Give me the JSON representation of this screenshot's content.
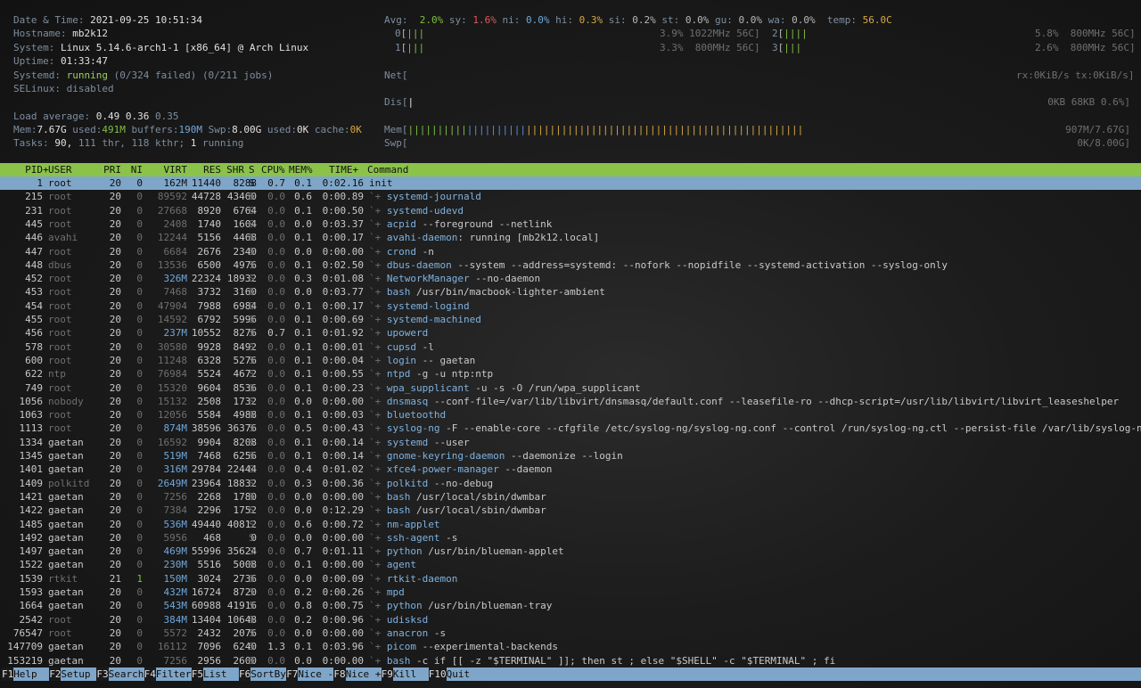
{
  "system": {
    "datetime_label": "Date & Time:",
    "datetime": "2021-09-25 10:51:34",
    "hostname_label": "Hostname:",
    "hostname": "mb2k12",
    "system_label": "System:",
    "system": "Linux 5.14.6-arch1-1 [x86_64] @ Arch Linux",
    "uptime_label": "Uptime:",
    "uptime": "01:33:47",
    "systemd_label": "Systemd:",
    "systemd_state": "running",
    "systemd_failed": "(0/324 failed)",
    "systemd_jobs": "(0/211 jobs)",
    "selinux_label": "SELinux:",
    "selinux": "disabled",
    "load_label": "Load average:",
    "load1": "0.49",
    "load5": "0.36",
    "load15": "0.35",
    "mem_label": "Mem:",
    "mem_total": "7.67G",
    "mem_used_label": "used:",
    "mem_used": "491M",
    "buffers_label": "buffers:",
    "buffers": "190M",
    "swp_label": "Swp:",
    "swp_total": "8.00G",
    "swp_used_label": "used:",
    "swp_used": "0K",
    "cache_label": "cache:",
    "cache": "0K",
    "tasks_label": "Tasks:",
    "tasks": "90,",
    "thr": "111 thr,",
    "kthr": "118 kthr;",
    "running": "1",
    "running_label": "running"
  },
  "cpu": {
    "avg_label": "Avg:",
    "stats": [
      {
        "label": "sy:",
        "value": "1.6%",
        "color": "#e05a5a"
      },
      {
        "label": "ni:",
        "value": "0.0%",
        "color": "#6fa8dc"
      },
      {
        "label": "hi:",
        "value": "0.3%",
        "color": "#d7a93f"
      },
      {
        "label": "si:",
        "value": "0.2%",
        "color": "#b8b8b8"
      },
      {
        "label": "st:",
        "value": "0.0%",
        "color": "#b8b8b8"
      },
      {
        "label": "gu:",
        "value": "0.0%",
        "color": "#b8b8b8"
      },
      {
        "label": "wa:",
        "value": "0.0%",
        "color": "#b8b8b8"
      }
    ],
    "avg_value": "2.0%",
    "temp_label": "temp:",
    "temp": "56.0C",
    "cores": [
      {
        "id": "0",
        "bars": "|||",
        "info": "3.9% 1022MHz 56C]"
      },
      {
        "id": "1",
        "bars": "|||",
        "info": "3.3%  800MHz 56C]"
      },
      {
        "id": "2",
        "bars": "||||",
        "info": "5.8%  800MHz 56C]"
      },
      {
        "id": "3",
        "bars": "|||",
        "info": "2.6%  800MHz 56C]"
      }
    ]
  },
  "meters": {
    "net_label": "Net[",
    "net_value": "rx:0KiB/s tx:0KiB/s]",
    "dis_label": "Dis[",
    "dis_value": "0KB 68KB 0.6%]",
    "mem_label": "Mem[",
    "mem_value": "907M/7.67G]",
    "swp_label": "Swp[",
    "swp_value": "0K/8.00G]"
  },
  "table": {
    "headers": [
      "PID",
      "USER",
      "PRI",
      "NI",
      "VIRT",
      "RES",
      "SHR",
      "S",
      "CPU%",
      "MEM%",
      "TIME+",
      "Command"
    ],
    "rows": [
      {
        "pid": "1",
        "user": "root",
        "pri": "20",
        "ni": "0",
        "virt": "162M",
        "res": "11440",
        "shr": "8288",
        "s": "S",
        "cpu": "0.7",
        "mem": "0.1",
        "time": "0:02.16",
        "cmd": "init",
        "args": ""
      },
      {
        "pid": "215",
        "user": "root",
        "pri": "20",
        "ni": "0",
        "virt": "89592",
        "res": "44728",
        "shr": "43460",
        "s": "S",
        "cpu": "0.0",
        "mem": "0.6",
        "time": "0:00.89",
        "cmd": "systemd-journald",
        "args": ""
      },
      {
        "pid": "231",
        "user": "root",
        "pri": "20",
        "ni": "0",
        "virt": "27668",
        "res": "8920",
        "shr": "6764",
        "s": "S",
        "cpu": "0.0",
        "mem": "0.1",
        "time": "0:00.50",
        "cmd": "systemd-udevd",
        "args": ""
      },
      {
        "pid": "445",
        "user": "root",
        "pri": "20",
        "ni": "0",
        "virt": "2408",
        "res": "1740",
        "shr": "1604",
        "s": "S",
        "cpu": "0.0",
        "mem": "0.0",
        "time": "0:03.37",
        "cmd": "acpid",
        "args": " --foreground --netlink"
      },
      {
        "pid": "446",
        "user": "avahi",
        "pri": "20",
        "ni": "0",
        "virt": "12244",
        "res": "5156",
        "shr": "4468",
        "s": "S",
        "cpu": "0.0",
        "mem": "0.1",
        "time": "0:00.17",
        "cmd": "avahi-daemon",
        "args": ": running [mb2k12.local]"
      },
      {
        "pid": "447",
        "user": "root",
        "pri": "20",
        "ni": "0",
        "virt": "6684",
        "res": "2676",
        "shr": "2340",
        "s": "S",
        "cpu": "0.0",
        "mem": "0.0",
        "time": "0:00.00",
        "cmd": "crond",
        "args": " -n"
      },
      {
        "pid": "448",
        "user": "dbus",
        "pri": "20",
        "ni": "0",
        "virt": "13536",
        "res": "6500",
        "shr": "4976",
        "s": "S",
        "cpu": "0.0",
        "mem": "0.1",
        "time": "0:02.50",
        "cmd": "dbus-daemon",
        "args": " --system --address=systemd: --nofork --nopidfile --systemd-activation --syslog-only"
      },
      {
        "pid": "452",
        "user": "root",
        "pri": "20",
        "ni": "0",
        "virt": "326M",
        "res": "22324",
        "shr": "18932",
        "s": "S",
        "cpu": "0.0",
        "mem": "0.3",
        "time": "0:01.08",
        "cmd": "NetworkManager",
        "args": " --no-daemon"
      },
      {
        "pid": "453",
        "user": "root",
        "pri": "20",
        "ni": "0",
        "virt": "7468",
        "res": "3732",
        "shr": "3160",
        "s": "S",
        "cpu": "0.0",
        "mem": "0.0",
        "time": "0:03.77",
        "cmd": "bash",
        "args": " /usr/bin/macbook-lighter-ambient"
      },
      {
        "pid": "454",
        "user": "root",
        "pri": "20",
        "ni": "0",
        "virt": "47904",
        "res": "7988",
        "shr": "6984",
        "s": "S",
        "cpu": "0.0",
        "mem": "0.1",
        "time": "0:00.17",
        "cmd": "systemd-logind",
        "args": ""
      },
      {
        "pid": "455",
        "user": "root",
        "pri": "20",
        "ni": "0",
        "virt": "14592",
        "res": "6792",
        "shr": "5996",
        "s": "S",
        "cpu": "0.0",
        "mem": "0.1",
        "time": "0:00.69",
        "cmd": "systemd-machined",
        "args": ""
      },
      {
        "pid": "456",
        "user": "root",
        "pri": "20",
        "ni": "0",
        "virt": "237M",
        "res": "10552",
        "shr": "8276",
        "s": "S",
        "cpu": "0.7",
        "mem": "0.1",
        "time": "0:01.92",
        "cmd": "upowerd",
        "args": ""
      },
      {
        "pid": "578",
        "user": "root",
        "pri": "20",
        "ni": "0",
        "virt": "30580",
        "res": "9928",
        "shr": "8492",
        "s": "S",
        "cpu": "0.0",
        "mem": "0.1",
        "time": "0:00.01",
        "cmd": "cupsd",
        "args": " -l"
      },
      {
        "pid": "600",
        "user": "root",
        "pri": "20",
        "ni": "0",
        "virt": "11248",
        "res": "6328",
        "shr": "5276",
        "s": "S",
        "cpu": "0.0",
        "mem": "0.1",
        "time": "0:00.04",
        "cmd": "login",
        "args": " -- gaetan"
      },
      {
        "pid": "622",
        "user": "ntp",
        "pri": "20",
        "ni": "0",
        "virt": "76984",
        "res": "5524",
        "shr": "4672",
        "s": "S",
        "cpu": "0.0",
        "mem": "0.1",
        "time": "0:00.55",
        "cmd": "ntpd",
        "args": " -g -u ntp:ntp"
      },
      {
        "pid": "749",
        "user": "root",
        "pri": "20",
        "ni": "0",
        "virt": "15320",
        "res": "9604",
        "shr": "8536",
        "s": "S",
        "cpu": "0.0",
        "mem": "0.1",
        "time": "0:00.23",
        "cmd": "wpa_supplicant",
        "args": " -u -s -O /run/wpa_supplicant"
      },
      {
        "pid": "1056",
        "user": "nobody",
        "pri": "20",
        "ni": "0",
        "virt": "15132",
        "res": "2508",
        "shr": "1732",
        "s": "S",
        "cpu": "0.0",
        "mem": "0.0",
        "time": "0:00.00",
        "cmd": "dnsmasq",
        "args": " --conf-file=/var/lib/libvirt/dnsmasq/default.conf --leasefile-ro --dhcp-script=/usr/lib/libvirt/libvirt_leaseshelper"
      },
      {
        "pid": "1063",
        "user": "root",
        "pri": "20",
        "ni": "0",
        "virt": "12056",
        "res": "5584",
        "shr": "4988",
        "s": "S",
        "cpu": "0.0",
        "mem": "0.1",
        "time": "0:00.03",
        "cmd": "bluetoothd",
        "args": ""
      },
      {
        "pid": "1113",
        "user": "root",
        "pri": "20",
        "ni": "0",
        "virt": "874M",
        "res": "38596",
        "shr": "36376",
        "s": "S",
        "cpu": "0.0",
        "mem": "0.5",
        "time": "0:00.43",
        "cmd": "syslog-ng",
        "args": " -F --enable-core --cfgfile /etc/syslog-ng/syslog-ng.conf --control /run/syslog-ng.ctl --persist-file /var/lib/syslog-ng/sysl"
      },
      {
        "pid": "1334",
        "user": "gaetan",
        "pri": "20",
        "ni": "0",
        "virt": "16592",
        "res": "9904",
        "shr": "8208",
        "s": "S",
        "cpu": "0.0",
        "mem": "0.1",
        "time": "0:00.14",
        "cmd": "systemd",
        "args": " --user"
      },
      {
        "pid": "1345",
        "user": "gaetan",
        "pri": "20",
        "ni": "0",
        "virt": "519M",
        "res": "7468",
        "shr": "6256",
        "s": "S",
        "cpu": "0.0",
        "mem": "0.1",
        "time": "0:00.14",
        "cmd": "gnome-keyring-daemon",
        "args": " --daemonize --login"
      },
      {
        "pid": "1401",
        "user": "gaetan",
        "pri": "20",
        "ni": "0",
        "virt": "316M",
        "res": "29784",
        "shr": "22444",
        "s": "S",
        "cpu": "0.0",
        "mem": "0.4",
        "time": "0:01.02",
        "cmd": "xfce4-power-manager",
        "args": " --daemon"
      },
      {
        "pid": "1409",
        "user": "polkitd",
        "pri": "20",
        "ni": "0",
        "virt": "2649M",
        "res": "23964",
        "shr": "18832",
        "s": "S",
        "cpu": "0.0",
        "mem": "0.3",
        "time": "0:00.36",
        "cmd": "polkitd",
        "args": " --no-debug"
      },
      {
        "pid": "1421",
        "user": "gaetan",
        "pri": "20",
        "ni": "0",
        "virt": "7256",
        "res": "2268",
        "shr": "1780",
        "s": "S",
        "cpu": "0.0",
        "mem": "0.0",
        "time": "0:00.00",
        "cmd": "bash",
        "args": " /usr/local/sbin/dwmbar"
      },
      {
        "pid": "1422",
        "user": "gaetan",
        "pri": "20",
        "ni": "0",
        "virt": "7384",
        "res": "2296",
        "shr": "1752",
        "s": "S",
        "cpu": "0.0",
        "mem": "0.0",
        "time": "0:12.29",
        "cmd": "bash",
        "args": " /usr/local/sbin/dwmbar"
      },
      {
        "pid": "1485",
        "user": "gaetan",
        "pri": "20",
        "ni": "0",
        "virt": "536M",
        "res": "49440",
        "shr": "40812",
        "s": "S",
        "cpu": "0.0",
        "mem": "0.6",
        "time": "0:00.72",
        "cmd": "nm-applet",
        "args": ""
      },
      {
        "pid": "1492",
        "user": "gaetan",
        "pri": "20",
        "ni": "0",
        "virt": "5956",
        "res": "468",
        "shr": "0",
        "s": "S",
        "cpu": "0.0",
        "mem": "0.0",
        "time": "0:00.00",
        "cmd": "ssh-agent",
        "args": " -s"
      },
      {
        "pid": "1497",
        "user": "gaetan",
        "pri": "20",
        "ni": "0",
        "virt": "469M",
        "res": "55996",
        "shr": "35624",
        "s": "S",
        "cpu": "0.0",
        "mem": "0.7",
        "time": "0:01.11",
        "cmd": "python",
        "args": " /usr/bin/blueman-applet"
      },
      {
        "pid": "1522",
        "user": "gaetan",
        "pri": "20",
        "ni": "0",
        "virt": "230M",
        "res": "5516",
        "shr": "5008",
        "s": "S",
        "cpu": "0.0",
        "mem": "0.1",
        "time": "0:00.00",
        "cmd": "agent",
        "args": ""
      },
      {
        "pid": "1539",
        "user": "rtkit",
        "pri": "21",
        "ni": "1",
        "virt": "150M",
        "res": "3024",
        "shr": "2736",
        "s": "S",
        "cpu": "0.0",
        "mem": "0.0",
        "time": "0:00.09",
        "cmd": "rtkit-daemon",
        "args": ""
      },
      {
        "pid": "1593",
        "user": "gaetan",
        "pri": "20",
        "ni": "0",
        "virt": "432M",
        "res": "16724",
        "shr": "8720",
        "s": "S",
        "cpu": "0.0",
        "mem": "0.2",
        "time": "0:00.26",
        "cmd": "mpd",
        "args": ""
      },
      {
        "pid": "1664",
        "user": "gaetan",
        "pri": "20",
        "ni": "0",
        "virt": "543M",
        "res": "60988",
        "shr": "41916",
        "s": "S",
        "cpu": "0.0",
        "mem": "0.8",
        "time": "0:00.75",
        "cmd": "python",
        "args": " /usr/bin/blueman-tray"
      },
      {
        "pid": "2542",
        "user": "root",
        "pri": "20",
        "ni": "0",
        "virt": "384M",
        "res": "13404",
        "shr": "10648",
        "s": "S",
        "cpu": "0.0",
        "mem": "0.2",
        "time": "0:00.96",
        "cmd": "udisksd",
        "args": ""
      },
      {
        "pid": "76547",
        "user": "root",
        "pri": "20",
        "ni": "0",
        "virt": "5572",
        "res": "2432",
        "shr": "2076",
        "s": "S",
        "cpu": "0.0",
        "mem": "0.0",
        "time": "0:00.00",
        "cmd": "anacron",
        "args": " -s"
      },
      {
        "pid": "147709",
        "user": "gaetan",
        "pri": "20",
        "ni": "0",
        "virt": "16112",
        "res": "7096",
        "shr": "6240",
        "s": "S",
        "cpu": "1.3",
        "mem": "0.1",
        "time": "0:03.96",
        "cmd": "picom",
        "args": " --experimental-backends"
      },
      {
        "pid": "153219",
        "user": "gaetan",
        "pri": "20",
        "ni": "0",
        "virt": "7256",
        "res": "2956",
        "shr": "2600",
        "s": "S",
        "cpu": "0.0",
        "mem": "0.0",
        "time": "0:00.00",
        "cmd": "bash",
        "args": " -c if [[ -z \"$TERMINAL\" ]]; then st ; else \"$SHELL\" -c \"$TERMINAL\" ; fi"
      }
    ]
  },
  "footer": [
    {
      "key": "F1",
      "label": "Help  "
    },
    {
      "key": "F2",
      "label": "Setup "
    },
    {
      "key": "F3",
      "label": "Search"
    },
    {
      "key": "F4",
      "label": "Filter"
    },
    {
      "key": "F5",
      "label": "List  "
    },
    {
      "key": "F6",
      "label": "SortBy"
    },
    {
      "key": "F7",
      "label": "Nice -"
    },
    {
      "key": "F8",
      "label": "Nice +"
    },
    {
      "key": "F9",
      "label": "Kill  "
    },
    {
      "key": "F10",
      "label": "Quit  "
    }
  ]
}
